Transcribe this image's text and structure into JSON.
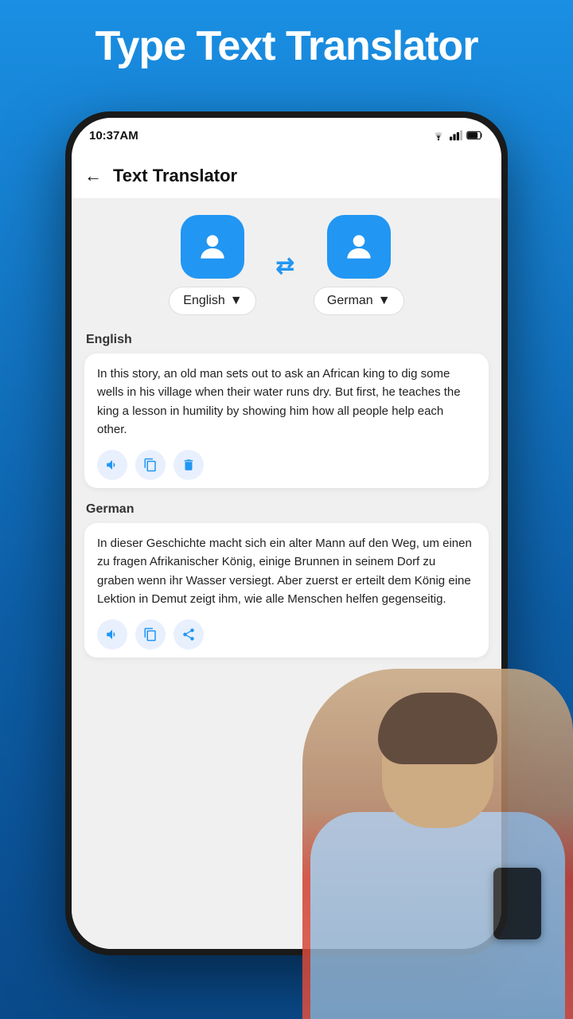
{
  "page": {
    "bg_title": "Type Text Translator",
    "status_time": "10:37AM"
  },
  "header": {
    "title": "Text Translator"
  },
  "languages": {
    "source": "English",
    "target": "German"
  },
  "source_section": {
    "label": "English",
    "text": "In this story, an old man sets out to ask an African king to dig some wells in his village when their water runs dry. But first, he teaches the king a lesson in humility by showing him how all people help each other."
  },
  "target_section": {
    "label": "German",
    "text": "In dieser Geschichte macht sich ein alter Mann auf den Weg, um einen zu fragen Afrikanischer König, einige Brunnen in seinem Dorf zu graben wenn ihr Wasser versiegt. Aber zuerst er erteilt dem König eine Lektion in Demut zeigt ihm, wie alle Menschen helfen gegenseitig."
  },
  "buttons": {
    "sound": "sound",
    "copy": "copy",
    "delete": "delete",
    "share": "share"
  }
}
